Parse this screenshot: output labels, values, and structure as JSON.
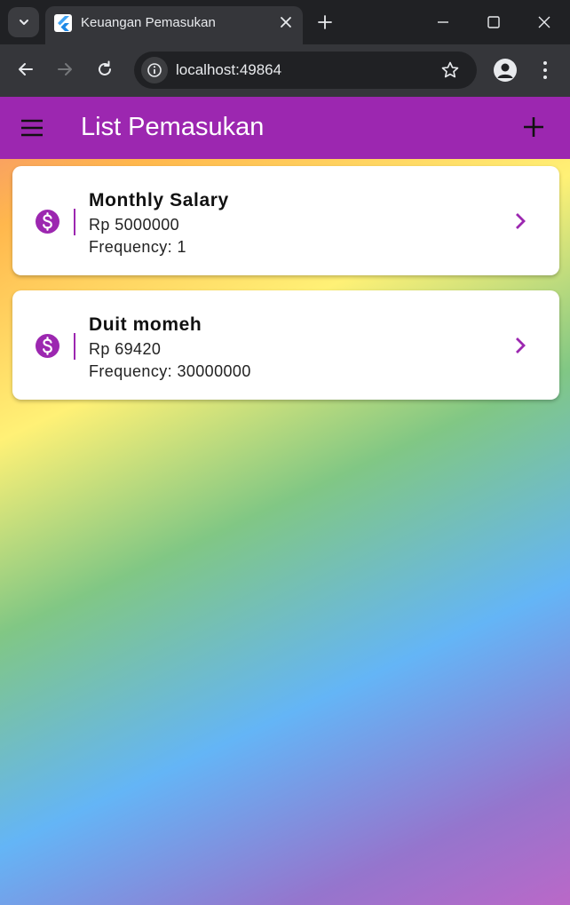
{
  "browser": {
    "tab_title": "Keuangan Pemasukan",
    "url": "localhost:49864"
  },
  "appbar": {
    "title": "List Pemasukan"
  },
  "incomes": [
    {
      "name": "Monthly Salary",
      "amount": "Rp 5000000",
      "frequency": "Frequency: 1"
    },
    {
      "name": "Duit momeh",
      "amount": "Rp 69420",
      "frequency": "Frequency: 30000000"
    }
  ],
  "colors": {
    "accent": "#9c27b0",
    "browser_frame": "#202124",
    "browser_toolbar": "#35363a"
  },
  "icons": {
    "drawer": "hamburger-menu-icon",
    "add": "plus-icon",
    "income": "dollar-circle-icon",
    "open": "chevron-right-icon"
  }
}
